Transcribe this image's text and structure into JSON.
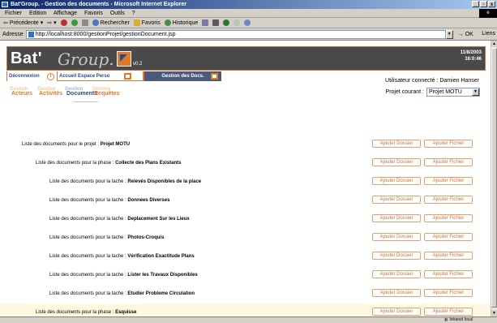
{
  "window": {
    "title": "Bat'Group. - Gestion des documents - Microsoft Internet Explorer",
    "controls": [
      "_",
      "▫",
      "x"
    ]
  },
  "menubar": [
    "Fichier",
    "Edition",
    "Affichage",
    "Favoris",
    "Outils",
    "?"
  ],
  "toolbar": {
    "back": "Précédente",
    "search": "Rechercher",
    "favorites": "Favoris",
    "history": "Historique"
  },
  "address": {
    "label": "Adresse",
    "url": "http://localhost:8000/gestionProjet/gestionDocument.jsp",
    "go": "OK",
    "links": "Liens"
  },
  "page": {
    "logo": {
      "bat": "Bat'",
      "group": "Group.",
      "version": "v0.2"
    },
    "date": "11/8/2003",
    "time": "16:0:46",
    "nav": {
      "deconnexion": "Déconnexion",
      "info": "i",
      "accueil": "Accueil Espace Perso",
      "docs": "Gestion des Docs."
    },
    "user": "Utilisateur connecté : Damien Hanser",
    "project_label": "Projet courant :",
    "project_value": "Projet MOTU",
    "subtabs": [
      {
        "ghost": "Gestion",
        "main": "Acteurs"
      },
      {
        "ghost": "Gestion",
        "main": "Activités"
      },
      {
        "ghost": "Gestion",
        "main": "Documents"
      },
      {
        "ghost": "Gestion",
        "main": "Requêtes"
      }
    ],
    "buttons": {
      "dossier": "Ajouter Dossier",
      "fichier": "Ajouter Fichier"
    },
    "rows": [
      {
        "prefix": "Liste des documents pour le projet :",
        "name": "Projet MOTU"
      },
      {
        "prefix": "Liste des documents pour la phase :",
        "name": "Collecte des Plans Existants"
      },
      {
        "prefix": "Liste des documents pour la tache :",
        "name": "Relevés Disponibles de la place"
      },
      {
        "prefix": "Liste des documents pour la tache :",
        "name": "Données Diverses"
      },
      {
        "prefix": "Liste des documents pour la tache :",
        "name": "Deplacement Sur les Lieux"
      },
      {
        "prefix": "Liste des documents pour la tache :",
        "name": "Photos-Croquis"
      },
      {
        "prefix": "Liste des documents pour la tache :",
        "name": "Vérification Exactitude Plans"
      },
      {
        "prefix": "Liste des documents pour la tache :",
        "name": "Lister les Travaux Disponibles"
      },
      {
        "prefix": "Liste des documents pour la tache :",
        "name": "Etudier Probleme Circulation"
      },
      {
        "prefix": "Liste des documents pour la phase :",
        "name": "Esquisse"
      }
    ]
  },
  "status": {
    "zone": "Intranet local"
  },
  "colors": {
    "accent": "#e07a2a",
    "header": "#4a4a4a",
    "navy": "#2a4a8a"
  }
}
